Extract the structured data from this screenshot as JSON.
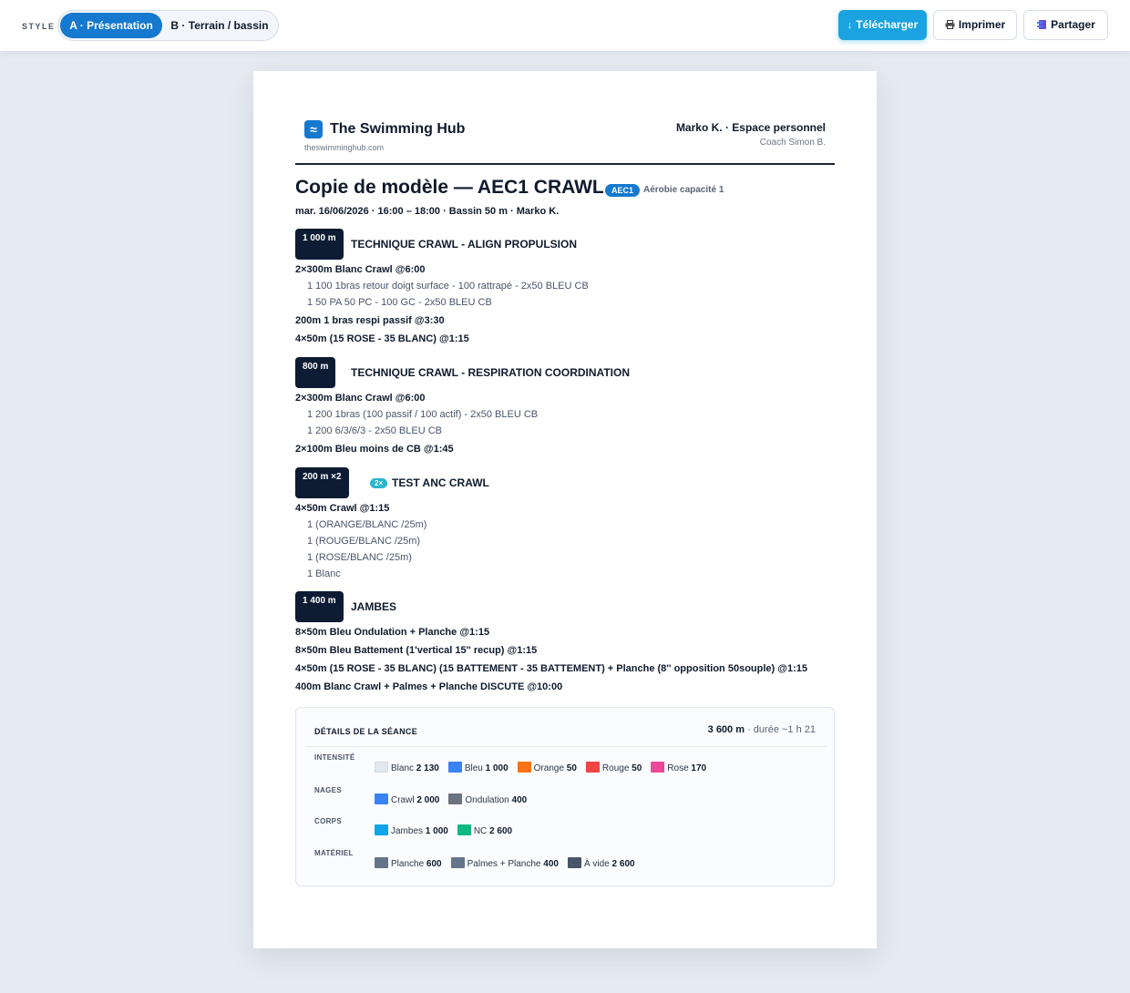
{
  "toolbar": {
    "style_label": "STYLE",
    "style_a": "A · Présentation",
    "style_b": "B · Terrain / bassin",
    "download_icon": "↓",
    "download_label": "Télécharger",
    "print_icon": "printer-icon",
    "print_label": "Imprimer",
    "share_icon": "share-icon",
    "share_label": "Partager"
  },
  "header": {
    "logo_glyph": "≈",
    "brand": "The Swimming Hub",
    "url": "theswimminghub.com",
    "user": "Marko K. · Espace personnel",
    "coach": "Coach Simon B."
  },
  "session": {
    "title": "Copie de modèle — AEC1 CRAWL",
    "badge": "AEC1",
    "badge_text": "Aérobie capacité 1",
    "meta": "mar. 16/06/2026 · 16:00 – 18:00 · Bassin 50 m · Marko K."
  },
  "blocks": [
    {
      "distance": "1 000 m",
      "title": "TECHNIQUE CRAWL - ALIGN PROPULSION",
      "sets": [
        {
          "text": "2×300m Blanc Crawl @6:00",
          "subs": [
            "1 100 1bras retour doigt surface - 100 rattrapé - 2x50 BLEU CB",
            "1 50 PA 50 PC - 100 GC - 2x50 BLEU CB"
          ]
        },
        {
          "text": "200m 1 bras respi passif @3:30",
          "subs": []
        },
        {
          "text": "4×50m (15 ROSE - 35 BLANC) @1:15",
          "subs": []
        }
      ]
    },
    {
      "distance": "800 m",
      "title": "TECHNIQUE CRAWL - RESPIRATION COORDINATION",
      "sets": [
        {
          "text": "2×300m Blanc Crawl @6:00",
          "subs": [
            "1 200 1bras (100 passif / 100 actif) - 2x50 BLEU CB",
            "1 200 6/3/6/3 - 2x50 BLEU CB"
          ]
        },
        {
          "text": "2×100m Bleu moins de CB @1:45",
          "subs": []
        }
      ]
    },
    {
      "distance": "200 m ×2",
      "rep_badge": "2×",
      "title": "TEST ANC CRAWL",
      "sets": [
        {
          "text": "4×50m Crawl @1:15",
          "subs": [
            "1 (ORANGE/BLANC /25m)",
            "1 (ROUGE/BLANC /25m)",
            "1 (ROSE/BLANC /25m)",
            "1 Blanc"
          ]
        }
      ]
    },
    {
      "distance": "1 400 m",
      "title": "JAMBES",
      "sets": [
        {
          "text": "8×50m Bleu Ondulation + Planche @1:15",
          "subs": []
        },
        {
          "text": "8×50m Bleu Battement (1'vertical 15'' recup) @1:15",
          "subs": []
        },
        {
          "text": "4×50m (15 ROSE - 35 BLANC) (15 BATTEMENT - 35 BATTEMENT) + Planche (8'' opposition 50souple) @1:15",
          "subs": []
        },
        {
          "text": "400m Blanc Crawl + Palmes + Planche DISCUTE @10:00",
          "subs": []
        }
      ]
    }
  ],
  "details": {
    "title": "DÉTAILS DE LA SÉANCE",
    "total": "3 600 m",
    "duration": "· durée ~1 h 21",
    "rows": [
      {
        "label": "INTENSITÉ",
        "items": [
          {
            "name": "Blanc",
            "value": "2 130",
            "color": "#e2e8f0"
          },
          {
            "name": "Bleu",
            "value": "1 000",
            "color": "#3b82f6"
          },
          {
            "name": "Orange",
            "value": "50",
            "color": "#f97316"
          },
          {
            "name": "Rouge",
            "value": "50",
            "color": "#ef4444"
          },
          {
            "name": "Rose",
            "value": "170",
            "color": "#ec4899"
          }
        ]
      },
      {
        "label": "NAGES",
        "items": [
          {
            "name": "Crawl",
            "value": "2 000",
            "color": "#3b82f6"
          },
          {
            "name": "Ondulation",
            "value": "400",
            "color": "#6b7280"
          }
        ]
      },
      {
        "label": "CORPS",
        "items": [
          {
            "name": "Jambes",
            "value": "1 000",
            "color": "#0ea5e9"
          },
          {
            "name": "NC",
            "value": "2 600",
            "color": "#10b981"
          }
        ]
      },
      {
        "label": "MATÉRIEL",
        "items": [
          {
            "name": "Planche",
            "value": "600",
            "color": "#64748b"
          },
          {
            "name": "Palmes + Planche",
            "value": "400",
            "color": "#64748b"
          },
          {
            "name": "À vide",
            "value": "2 600",
            "color": "#475569"
          }
        ]
      }
    ]
  }
}
